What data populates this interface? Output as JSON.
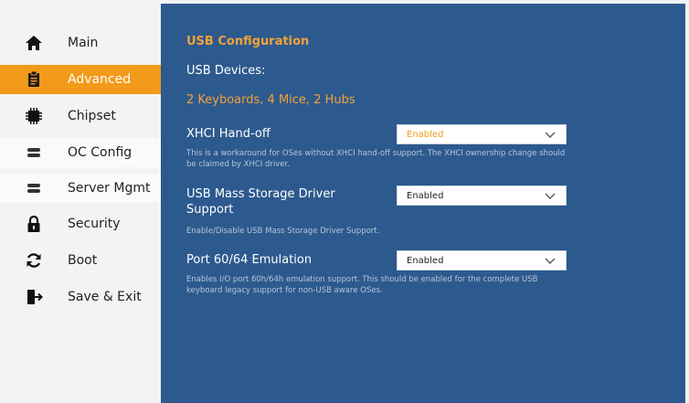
{
  "sidebar": {
    "items": [
      {
        "label": "Main",
        "icon": "home-icon"
      },
      {
        "label": "Advanced",
        "icon": "clipboard-icon",
        "active": true
      },
      {
        "label": "Chipset",
        "icon": "chip-icon"
      },
      {
        "label": "OC Config",
        "icon": "toggle-icon"
      },
      {
        "label": "Server Mgmt",
        "icon": "toggle-icon"
      },
      {
        "label": "Security",
        "icon": "lock-icon"
      },
      {
        "label": "Boot",
        "icon": "refresh-icon"
      },
      {
        "label": "Save & Exit",
        "icon": "exit-icon"
      }
    ]
  },
  "main": {
    "title": "USB Configuration",
    "usb_devices_label": "USB Devices:",
    "usb_devices_summary": "2 Keyboards, 4 Mice, 2 Hubs",
    "settings": [
      {
        "title": "XHCI Hand-off",
        "value": "Enabled",
        "description": "This is a workaround for OSes without XHCI hand-off support. The XHCI ownership change should be claimed by XHCI driver."
      },
      {
        "title": "USB Mass Storage Driver Support",
        "value": "Enabled",
        "description": "Enable/Disable USB Mass Storage Driver Support."
      },
      {
        "title": "Port 60/64 Emulation",
        "value": "Enabled",
        "description": "Enables I/O port 60h/64h emulation support. This should be enabled for the complete USB keyboard legacy support for non-USB aware OSes."
      }
    ]
  },
  "colors": {
    "accent": "#f29a1a",
    "panel": "#2d5a8e",
    "sidebar": "#f3f3f3"
  }
}
